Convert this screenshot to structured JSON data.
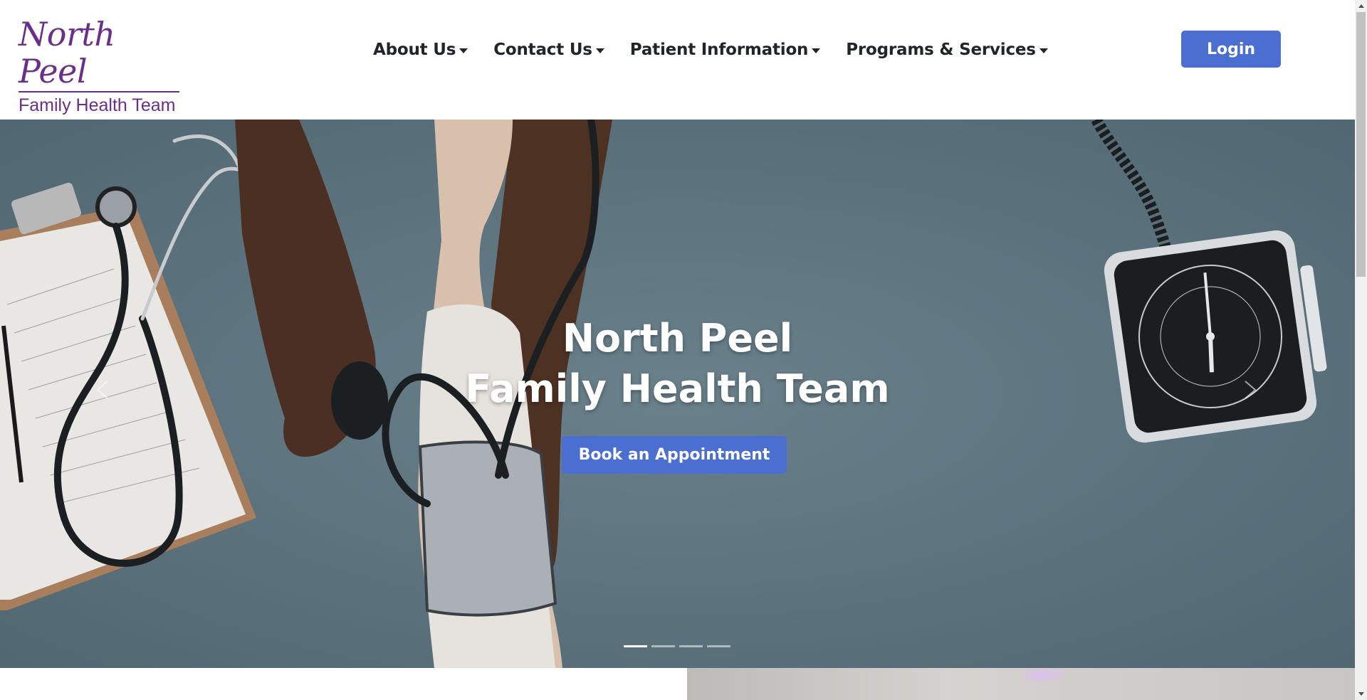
{
  "brand": {
    "logo_line1": "North Peel",
    "logo_line2": "Family Health Team",
    "color": "#6b2f8a"
  },
  "nav": {
    "items": [
      {
        "label": "About Us",
        "icon": "caret-down-icon"
      },
      {
        "label": "Contact Us",
        "icon": "caret-down-icon"
      },
      {
        "label": "Patient Information",
        "icon": "caret-down-icon"
      },
      {
        "label": "Programs & Services",
        "icon": "caret-down-icon"
      }
    ],
    "login_label": "Login"
  },
  "hero": {
    "title_line1": "North Peel",
    "title_line2": "Family Health Team",
    "cta_label": "Book an Appointment",
    "slide_count": 4,
    "active_slide": 1,
    "image_description_icons": [
      "stethoscope",
      "clipboard",
      "blood-pressure-cuff",
      "pressure-gauge"
    ]
  },
  "colors": {
    "accent": "#4a6fd1",
    "hero_bg": "#5c7480",
    "text_dark": "#212529"
  }
}
